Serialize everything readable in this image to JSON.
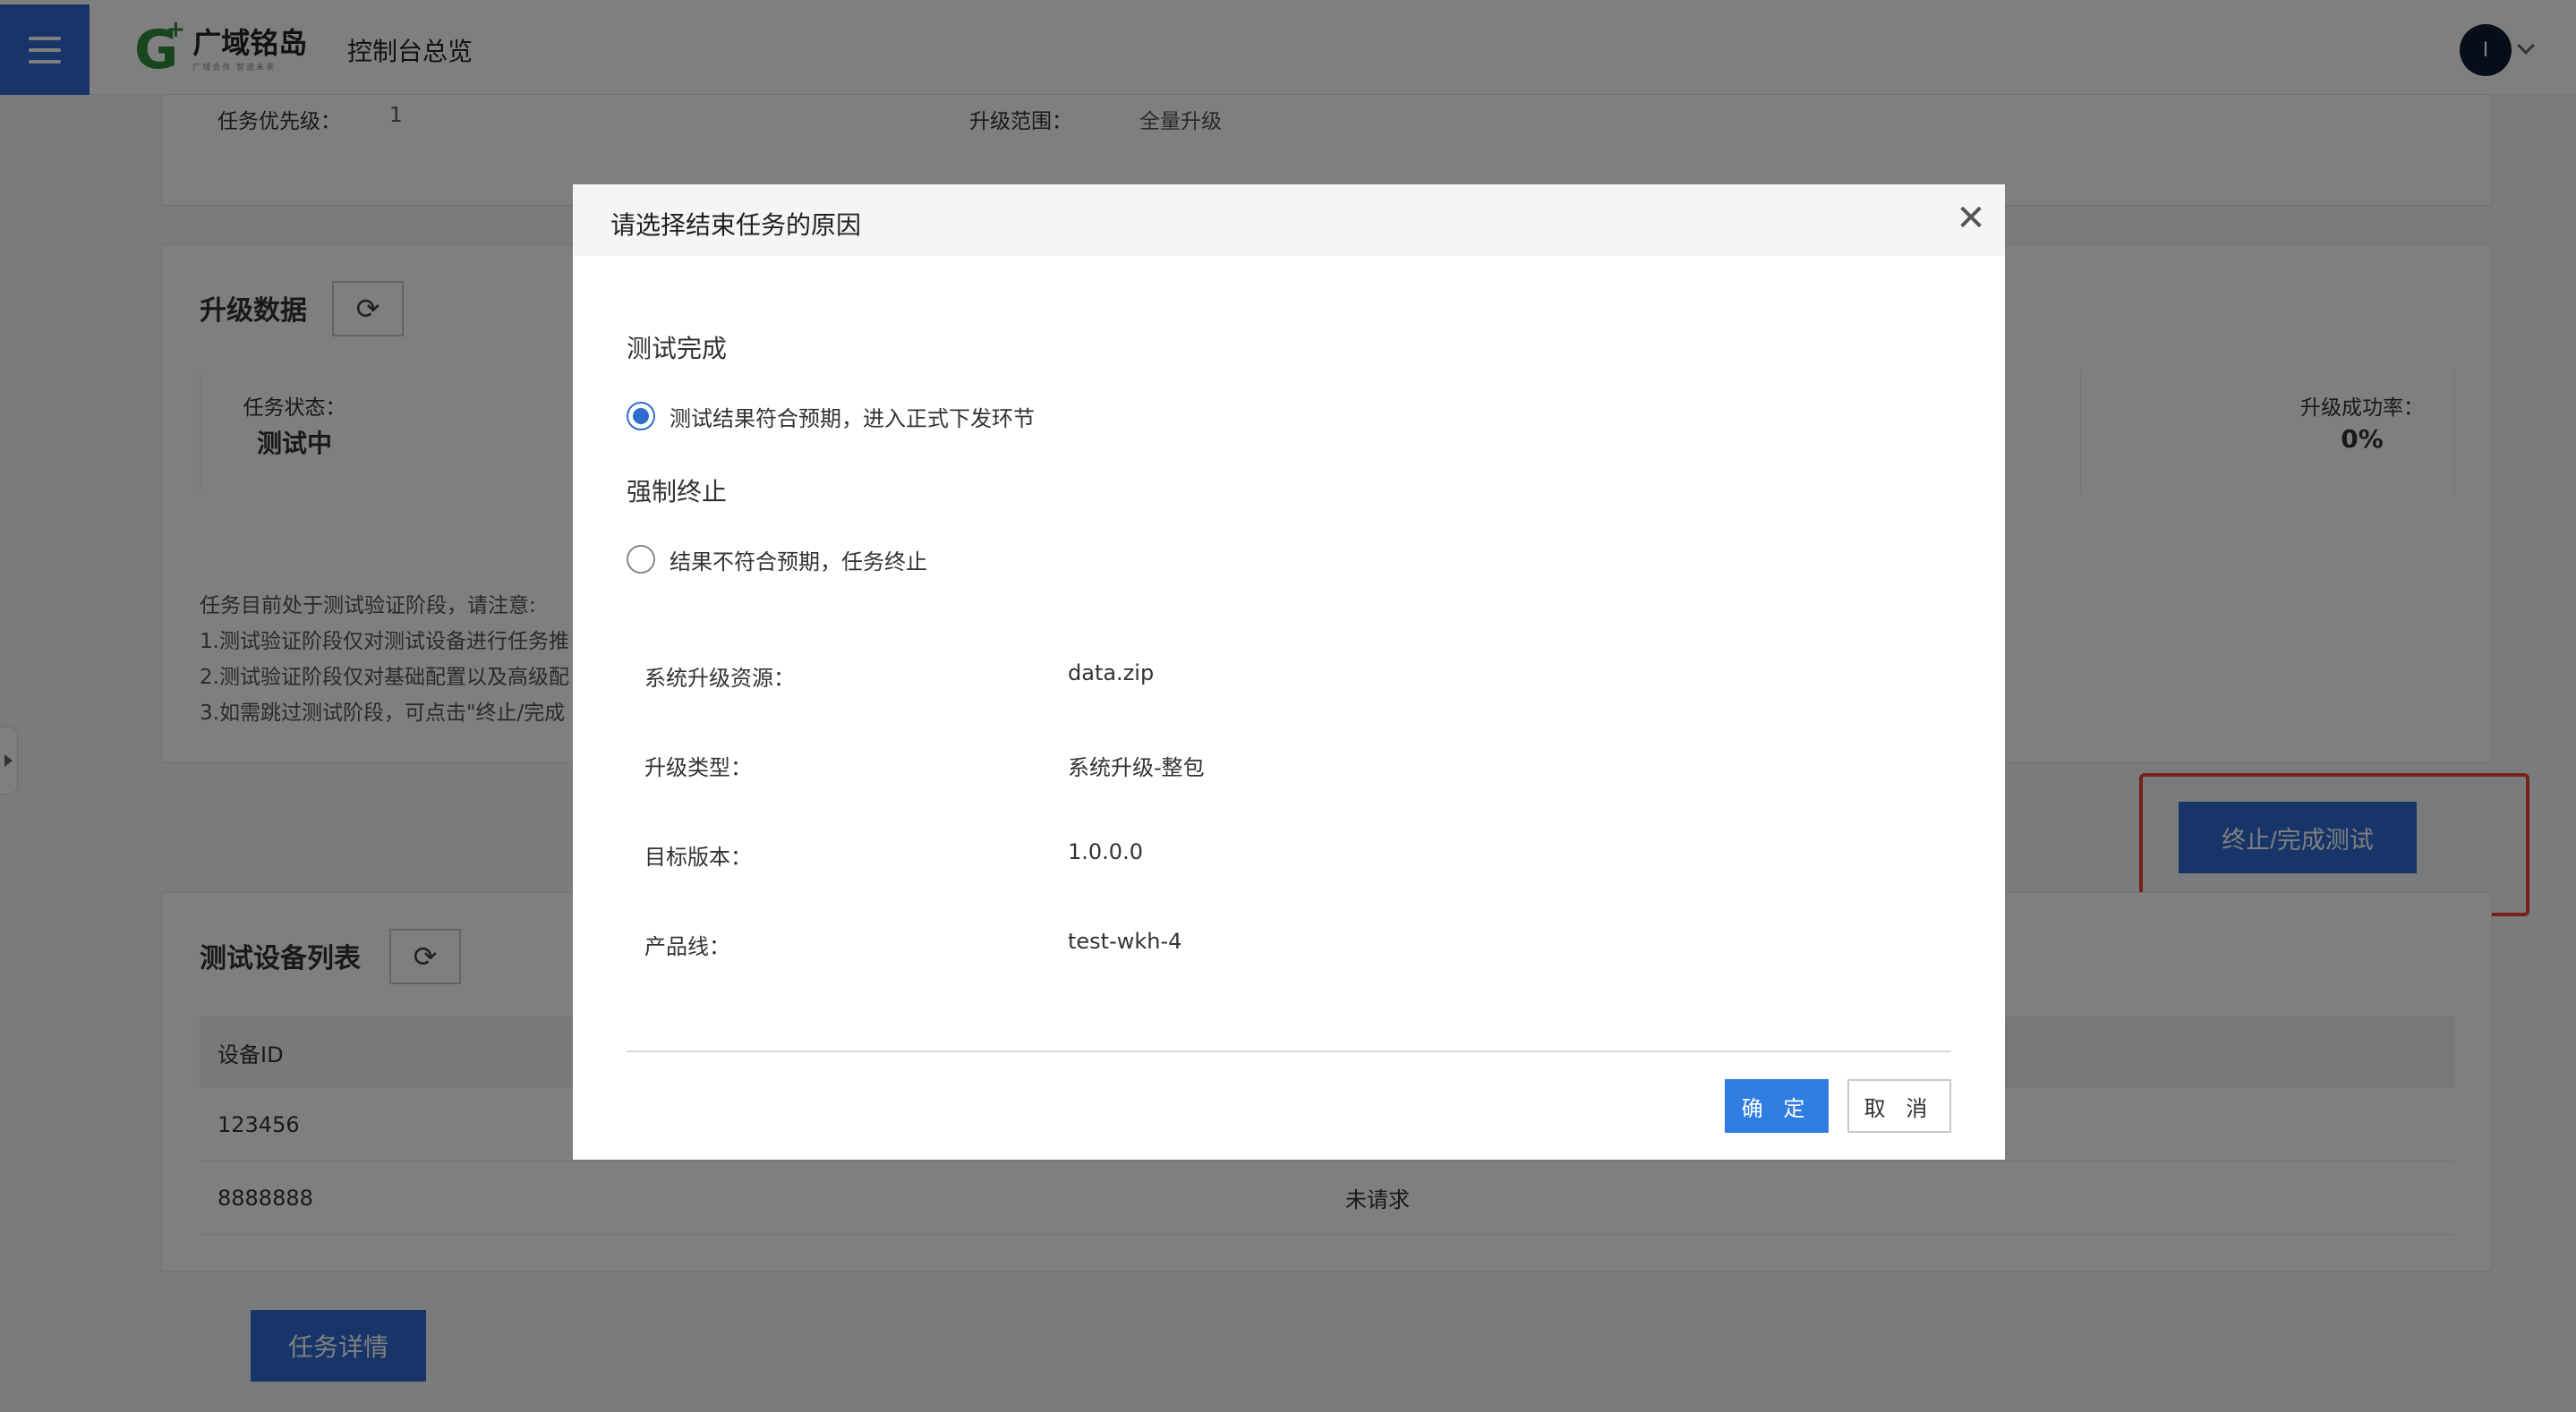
{
  "header": {
    "brand_name": "广域铭岛",
    "brand_slogan": "广域合作 智造未来",
    "page_title": "控制台总览",
    "avatar_initial": "I"
  },
  "task_info": {
    "priority_label": "任务优先级：",
    "priority_value": "1",
    "scope_label": "升级范围：",
    "scope_value": "全量升级"
  },
  "upgrade_data": {
    "title": "升级数据",
    "stats": [
      {
        "label": "任务状态：",
        "value": "测试中"
      },
      {
        "label": "升级成功率：",
        "value": "0%"
      }
    ],
    "notes": [
      "任务目前处于测试验证阶段，请注意:",
      "1.测试验证阶段仅对测试设备进行任务推",
      "2.测试验证阶段仅对基础配置以及高级配",
      "3.如需跳过测试阶段，可点击\"终止/完成"
    ],
    "terminate_button": "终止/完成测试"
  },
  "test_devices": {
    "title": "测试设备列表",
    "columns": [
      "设备ID"
    ],
    "rows": [
      {
        "id": "123456",
        "status": ""
      },
      {
        "id": "8888888",
        "status": "未请求"
      }
    ]
  },
  "footer": {
    "detail_button": "任务详情"
  },
  "modal": {
    "title": "请选择结束任务的原因",
    "group1_title": "测试完成",
    "option1_label": "测试结果符合预期，进入正式下发环节",
    "option1_checked": true,
    "group2_title": "强制终止",
    "option2_label": "结果不符合预期，任务终止",
    "option2_checked": false,
    "info": [
      {
        "label": "系统升级资源：",
        "value": "data.zip"
      },
      {
        "label": "升级类型：",
        "value": "系统升级-整包"
      },
      {
        "label": "目标版本：",
        "value": "1.0.0.0"
      },
      {
        "label": "产品线：",
        "value": "test-wkh-4"
      }
    ],
    "confirm_label": "确 定",
    "cancel_label": "取 消"
  },
  "colors": {
    "primary": "#2f6bd1",
    "confirm": "#2f7de1",
    "highlight": "#e8442f",
    "brand_green": "#2e8b3a"
  }
}
